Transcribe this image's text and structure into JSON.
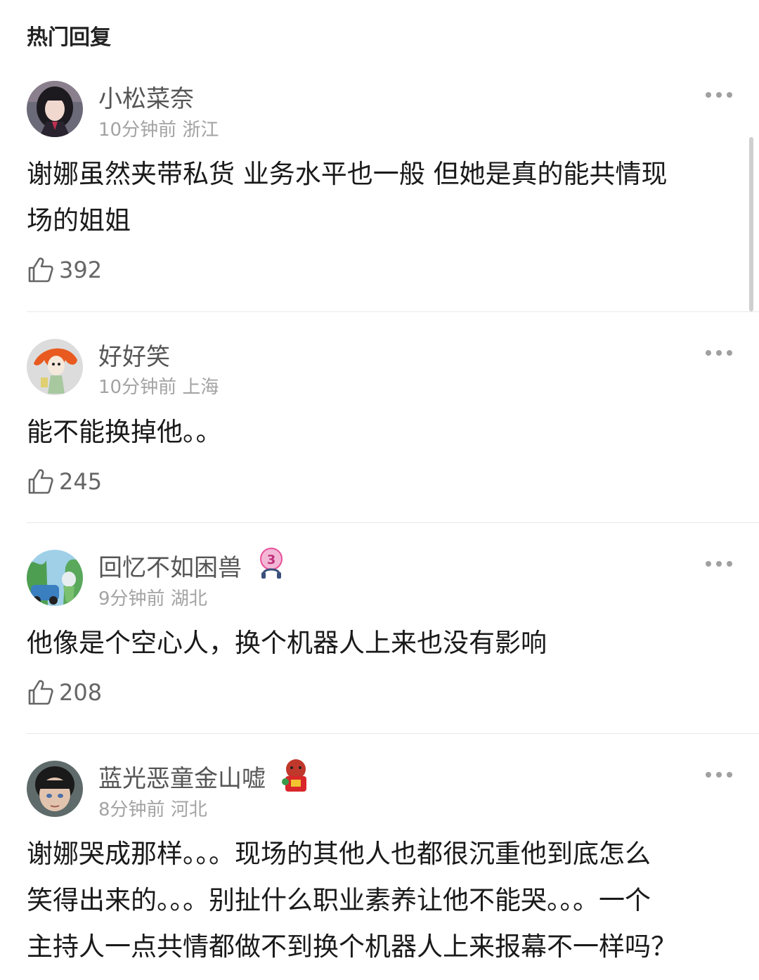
{
  "header": {
    "title": "热门回复"
  },
  "comments": [
    {
      "username": "小松菜奈",
      "time": "10分钟前",
      "location": "浙江",
      "text_lines": [
        "谢娜虽然夹带私货 业务水平也一般 但她是真的能共情现",
        "场的姐姐"
      ],
      "likes": "392"
    },
    {
      "username": "好好笑",
      "time": "10分钟前",
      "location": "上海",
      "text_lines": [
        "能不能换掉他。。"
      ],
      "likes": "245"
    },
    {
      "username": "回忆不如困兽",
      "badge_text": "3",
      "time": "9分钟前",
      "location": "湖北",
      "text_lines": [
        "他像是个空心人，换个机器人上来也没有影响"
      ],
      "likes": "208"
    },
    {
      "username": "蓝光恶童金山嘘",
      "time": "8分钟前",
      "location": "河北",
      "text_lines": [
        "谢娜哭成那样。。。现场的其他人也都很沉重他到底怎么",
        "笑得出来的。。。别扯什么职业素养让他不能哭。。。一个",
        "主持人一点共情都做不到换个机器人上来报幕不一样吗？"
      ]
    }
  ],
  "icons": {
    "like": "thumbs-up-icon",
    "more": "more-dots-icon",
    "vip_badge": "headphone-level-badge-icon",
    "sticker_badge": "red-bag-sticker-icon"
  },
  "colors": {
    "username": "#555555",
    "meta": "#a3a3a3",
    "text": "#1a1a1a",
    "badge_pink": "#e8509a"
  }
}
